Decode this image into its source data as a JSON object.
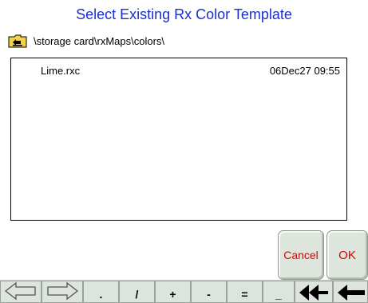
{
  "dialog": {
    "title": "Select Existing Rx Color Template",
    "path": "\\storage card\\rxMaps\\colors\\",
    "folder_icon": "folder-up-icon"
  },
  "files": [
    {
      "name": "Lime.rxc",
      "date": "06Dec27 09:55"
    }
  ],
  "buttons": {
    "cancel": "Cancel",
    "ok": "OK"
  },
  "keys": {
    "left_arrow": "arrow-left-outline-icon",
    "right_arrow": "arrow-right-outline-icon",
    "dot": ".",
    "slash": "/",
    "plus": "+",
    "minus": "-",
    "equals": "=",
    "underscore": "_",
    "backspace_all": "double-backspace-icon",
    "backspace": "backspace-icon"
  },
  "colors": {
    "title": "#1a2fd0",
    "button_text": "#e00000",
    "button_bg": "#dde5dc",
    "folder_yellow": "#f2d24a"
  }
}
